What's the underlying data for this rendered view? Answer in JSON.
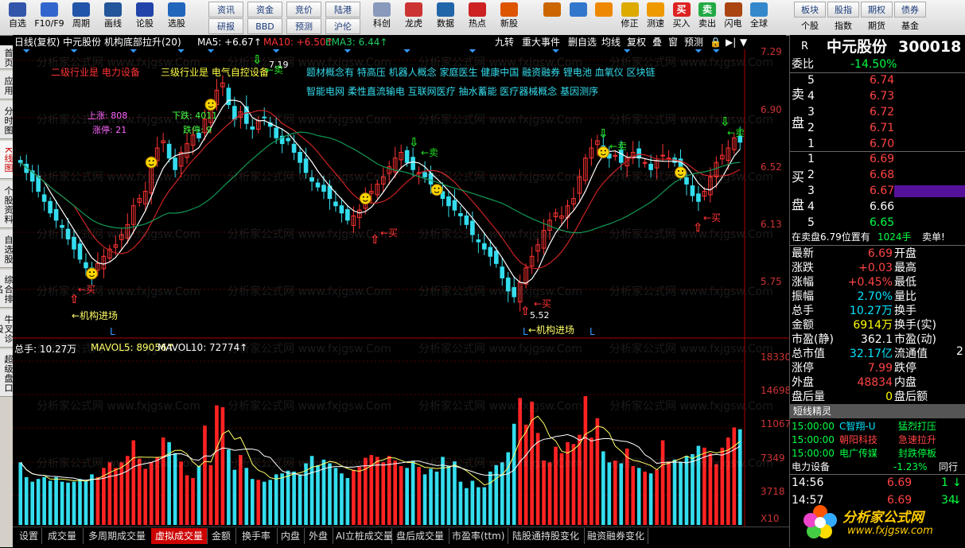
{
  "toolbar": {
    "row1": [
      {
        "label": "自选",
        "icon": "star-icon"
      },
      {
        "label": "F10/F9",
        "icon": "document-icon"
      },
      {
        "label": "周期",
        "icon": "clock-icon"
      },
      {
        "label": "画线",
        "icon": "pencil-icon"
      },
      {
        "label": "论股",
        "icon": "chat-icon"
      },
      {
        "label": "选股",
        "icon": "target-icon"
      }
    ],
    "grid": [
      [
        "资讯",
        "资金",
        "竞价",
        "陆港"
      ],
      [
        "研报",
        "BBD",
        "预测",
        "沪伦"
      ]
    ],
    "row2": [
      {
        "label": "科创",
        "icon": "chart-icon"
      },
      {
        "label": "龙虎",
        "icon": "dragon-icon"
      },
      {
        "label": "数据",
        "icon": "pe-icon"
      },
      {
        "label": "热点",
        "icon": "hot-icon"
      },
      {
        "label": "新股",
        "icon": "new-icon"
      }
    ],
    "row3": [
      {
        "label": "",
        "icon": "grid-icon"
      },
      {
        "label": "",
        "icon": "back-arrow-icon"
      },
      {
        "label": "",
        "icon": "up-down-icon"
      },
      {
        "label": "修正",
        "icon": "refresh-icon"
      },
      {
        "label": "测速",
        "icon": "speed-icon"
      },
      {
        "label": "买入",
        "icon": "buy-icon",
        "icon_text": "买"
      },
      {
        "label": "卖出",
        "icon": "sell-icon",
        "icon_text": "卖"
      },
      {
        "label": "闪电",
        "icon": "hammer-icon"
      },
      {
        "label": "全球",
        "icon": "globe-icon"
      }
    ],
    "grid2": [
      [
        "板块",
        "股指",
        "期权",
        "债券"
      ],
      [
        "个股",
        "指数",
        "期货",
        "基金"
      ]
    ]
  },
  "left_tabs": [
    "首页",
    "应用",
    "分时图",
    "K线图",
    "个股资料",
    "自选股",
    "综合排名",
    "牛叉诊股",
    "超级盘口"
  ],
  "chart_header": {
    "title": "日线(复权) 中元股份 机构底部拉升(20)",
    "ma5": "MA5: +6.67↑",
    "ma10": "MA10: +6.50↑",
    "ema3": "EMA3: 6.44↑",
    "buttons": [
      "九转",
      "重大事件",
      "删自选",
      "均线",
      "复权",
      "叠",
      "窗",
      "预测"
    ]
  },
  "sector": {
    "level2": "二级行业是 电力设备",
    "level3": "三级行业是 电气自控设备",
    "concepts_line1": "题材概念有 特高压 机器人概念 家庭医生 健康中国 融资融券 锂电池 血氧仪 区块链",
    "concepts_line2": "智能电网 柔性直流输电 互联网医疗 抽水蓄能 医疗器械概念 基因测序",
    "up_label": "上涨: 808",
    "limit_up_label": "涨停: 21",
    "down_label": "下跌: 4011",
    "limit_down_label": "跌停: 9"
  },
  "price_axis": [
    "7.29",
    "6.90",
    "6.52",
    "6.13",
    "5.75"
  ],
  "price_marks": {
    "high": "7.19",
    "low": "5.52"
  },
  "annotations": {
    "buy": "←买",
    "sell": "←卖",
    "institution": "←机构进场",
    "L": "L"
  },
  "volume_header": {
    "total": "总手: 10.27万",
    "mavol5": "MAVOL5: 89056↑",
    "mavol10": "MAVOL10: 72774↑"
  },
  "volume_axis": [
    "18330",
    "14698",
    "11067",
    "7349",
    "3718",
    "X10"
  ],
  "bottom_tabs": [
    "设置",
    "成交量",
    "多周期成交量",
    "虚拟成交量",
    "金额",
    "换手率",
    "内盘",
    "外盘",
    "AI立桩成交量",
    "盘后成交量",
    "市盈率(ttm)",
    "陆股通持股变化",
    "融资融券变化"
  ],
  "bottom_active": "虚拟成交量",
  "watermark": "分析家公式网 www.fxjgsw.Com",
  "right_panel": {
    "r_label": "R",
    "stock_name": "中元股份",
    "stock_code": "300018",
    "weibi_label": "委比",
    "weibi_value": "-14.50%",
    "sell_label": [
      "卖",
      "盘"
    ],
    "buy_label": [
      "买",
      "盘"
    ],
    "asks": [
      {
        "n": "5",
        "price": "6.74"
      },
      {
        "n": "4",
        "price": "6.73"
      },
      {
        "n": "3",
        "price": "6.72"
      },
      {
        "n": "2",
        "price": "6.71"
      },
      {
        "n": "1",
        "price": "6.70"
      }
    ],
    "bids": [
      {
        "n": "1",
        "price": "6.69"
      },
      {
        "n": "2",
        "price": "6.68"
      },
      {
        "n": "3",
        "price": "6.67"
      },
      {
        "n": "4",
        "price": "6.66"
      },
      {
        "n": "5",
        "price": "6.65"
      }
    ],
    "position_note": "在卖盘6.79位置有",
    "position_qty": "1024手",
    "position_tag": "卖单!",
    "stats": [
      {
        "l": "最新",
        "v": "6.69",
        "vc": "red",
        "r": "开盘"
      },
      {
        "l": "涨跌",
        "v": "+0.03",
        "vc": "red",
        "r": "最高"
      },
      {
        "l": "涨幅",
        "v": "+0.45%",
        "vc": "red",
        "r": "最低"
      },
      {
        "l": "振幅",
        "v": "2.70%",
        "vc": "cyan",
        "r": "量比"
      },
      {
        "l": "总手",
        "v": "10.27万",
        "vc": "cyan",
        "r": "换手"
      },
      {
        "l": "金额",
        "v": "6914万",
        "vc": "yel",
        "r": "换手(实)"
      },
      {
        "l": "市盈(静)",
        "v": "362.1",
        "vc": "lbl",
        "r": "市盈(动)"
      },
      {
        "l": "总市值",
        "v": "32.17亿",
        "vc": "cyan",
        "r": "流通值"
      },
      {
        "l": "涨停",
        "v": "7.99",
        "vc": "red",
        "r": "跌停"
      },
      {
        "l": "外盘",
        "v": "48834",
        "vc": "red",
        "r": "内盘"
      },
      {
        "l": "盘后量",
        "v": "0",
        "vc": "yel",
        "r": "盘后额"
      }
    ],
    "stats_extra": "2!",
    "short_title": "短线精灵",
    "short_rows": [
      {
        "time": "15:00:00",
        "name": "C智翔-U",
        "event": "猛烈打压",
        "nc": "cyan",
        "ec": "grn"
      },
      {
        "time": "15:00:00",
        "name": "朝阳科技",
        "event": "急速拉升",
        "nc": "red",
        "ec": "red"
      },
      {
        "time": "15:00:00",
        "name": "电广传媒",
        "event": "封跌停板",
        "nc": "grn",
        "ec": "grn"
      }
    ],
    "sector_row": {
      "name": "电力设备",
      "change": "-1.23%",
      "next": "同行"
    },
    "ticks": [
      {
        "time": "14:56",
        "price": "6.69",
        "vol": "1"
      },
      {
        "time": "14:57",
        "price": "6.69",
        "vol": "34"
      }
    ]
  },
  "logo": {
    "title": "分析家公式网",
    "url": "www.fxjgsw.com"
  },
  "colors": {
    "rise": "#ff3333",
    "fall": "#33ddee",
    "ma5": "#ffffff",
    "ma10": "#cc2222",
    "ema": "#119955",
    "volume_ma5": "#ffff66",
    "volume_ma10": "#ffffff"
  },
  "chart_data": {
    "type": "candlestick",
    "price_range": [
      5.52,
      7.19
    ],
    "closes": [
      6.55,
      6.48,
      6.42,
      6.35,
      6.28,
      6.2,
      6.15,
      6.1,
      6.02,
      5.95,
      5.88,
      5.82,
      5.78,
      5.85,
      5.9,
      5.95,
      5.98,
      6.05,
      6.12,
      6.25,
      6.3,
      6.35,
      6.55,
      6.65,
      6.7,
      6.58,
      6.5,
      6.62,
      6.68,
      6.74,
      6.72,
      6.85,
      6.95,
      7.05,
      7.1,
      6.95,
      6.85,
      6.9,
      6.82,
      6.78,
      6.84,
      6.86,
      6.8,
      6.72,
      6.68,
      6.7,
      6.62,
      6.55,
      6.48,
      6.42,
      6.38,
      6.35,
      6.3,
      6.25,
      6.2,
      6.15,
      6.18,
      6.22,
      6.3,
      6.35,
      6.4,
      6.45,
      6.52,
      6.58,
      6.62,
      6.55,
      6.5,
      6.48,
      6.45,
      6.4,
      6.36,
      6.3,
      6.25,
      6.22,
      6.18,
      6.12,
      6.05,
      6.0,
      5.95,
      5.9,
      5.85,
      5.75,
      5.66,
      5.62,
      5.72,
      5.82,
      5.9,
      5.98,
      6.08,
      6.15,
      6.2,
      6.18,
      6.25,
      6.3,
      6.45,
      6.58,
      6.65,
      6.7,
      6.62,
      6.58,
      6.6,
      6.55,
      6.58,
      6.62,
      6.58,
      6.55,
      6.5,
      6.56,
      6.6,
      6.58,
      6.55,
      6.48,
      6.4,
      6.32,
      6.28,
      6.35,
      6.45,
      6.55,
      6.6,
      6.65,
      6.72,
      6.69
    ],
    "volumes": [
      6800,
      5200,
      4700,
      5000,
      5200,
      4800,
      5200,
      4700,
      4600,
      4700,
      5000,
      4800,
      5500,
      5200,
      6200,
      6800,
      6200,
      6800,
      7500,
      9200,
      7200,
      6100,
      6800,
      7400,
      9500,
      9000,
      7800,
      6900,
      5400,
      5100,
      6400,
      10800,
      6500,
      13000,
      12800,
      8200,
      6000,
      7600,
      6200,
      5000,
      4900,
      4700,
      4900,
      5500,
      5600,
      5900,
      5800,
      5500,
      6700,
      7500,
      6500,
      7100,
      6700,
      6200,
      5600,
      5100,
      6000,
      6300,
      7300,
      7600,
      7400,
      6800,
      7500,
      7000,
      6400,
      6200,
      6900,
      6300,
      5500,
      6100,
      5800,
      7400,
      6400,
      6900,
      4700,
      4000,
      4800,
      4100,
      4100,
      5800,
      6500,
      6800,
      7900,
      11000,
      13800,
      10900,
      13400,
      10000,
      7000,
      6800,
      8500,
      7800,
      9000,
      8800,
      9800,
      14000,
      9500,
      11600,
      8000,
      6800,
      7000,
      6700,
      8300,
      6400,
      6200,
      5800,
      5600,
      6000,
      9200,
      6900,
      7100,
      6800,
      7500,
      7700,
      8600,
      8400,
      7800,
      6600,
      8400,
      9500,
      10600,
      10400
    ]
  }
}
